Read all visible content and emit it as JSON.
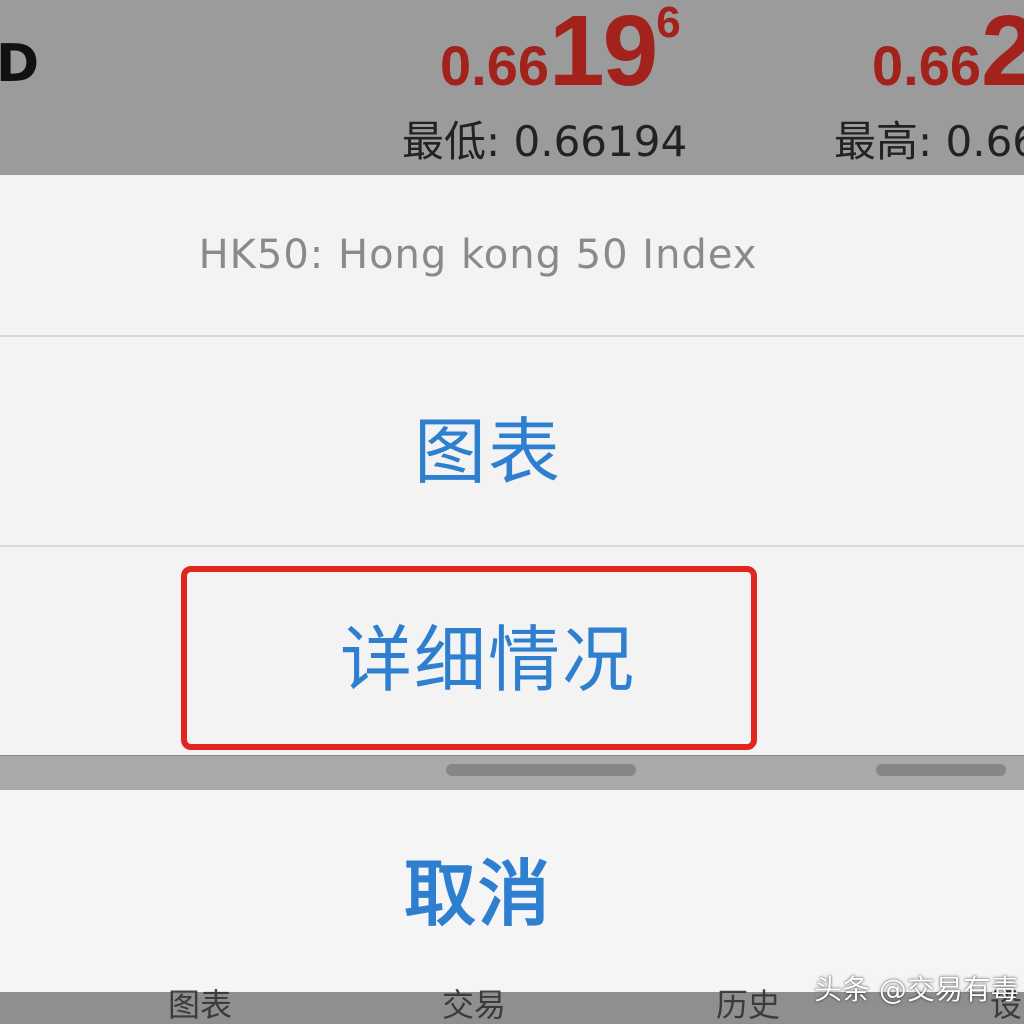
{
  "quote": {
    "symbol_partial": "D",
    "bid": {
      "prefix": "0.66",
      "big": "19",
      "sup": "6"
    },
    "ask": {
      "prefix": "0.66",
      "big": "2"
    },
    "low": "最低: 0.66194",
    "high": "最高: 0.66"
  },
  "action_sheet": {
    "title": "HK50: Hong kong 50 Index",
    "chart_label": "图表",
    "details_label": "详细情况",
    "cancel_label": "取消"
  },
  "tabbar": {
    "charts": "图表",
    "trade": "交易",
    "history": "历史",
    "settings": "设"
  },
  "watermark": "头条 @交易有毒",
  "colors": {
    "price_red": "#a3221c",
    "action_blue": "#2f7fd0",
    "highlight_red": "#e0261f"
  }
}
